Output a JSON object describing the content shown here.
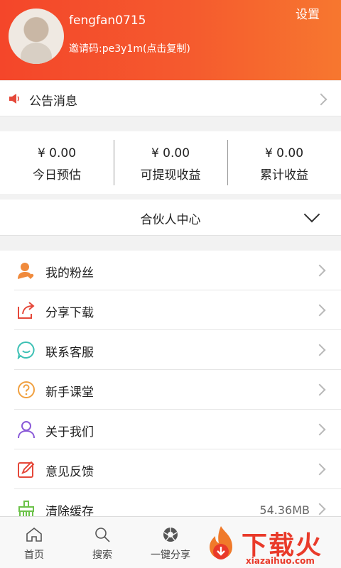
{
  "header": {
    "username": "fengfan0715",
    "invite": "邀请码:pe3y1m(点击复制)",
    "settings": "设置"
  },
  "notice": {
    "label": "公告消息"
  },
  "earnings": [
    {
      "amount": "¥ 0.00",
      "caption": "今日预估"
    },
    {
      "amount": "¥ 0.00",
      "caption": "可提现收益"
    },
    {
      "amount": "¥ 0.00",
      "caption": "累计收益"
    }
  ],
  "partner": {
    "title": "合伙人中心"
  },
  "menu": [
    {
      "label": "我的粉丝",
      "icon": "fans-icon",
      "color": "#f08a3c"
    },
    {
      "label": "分享下载",
      "icon": "share-icon",
      "color": "#e5483a"
    },
    {
      "label": "联系客服",
      "icon": "service-icon",
      "color": "#3cc0b4"
    },
    {
      "label": "新手课堂",
      "icon": "question-icon",
      "color": "#f0a040"
    },
    {
      "label": "关于我们",
      "icon": "user-icon",
      "color": "#8a5ad8"
    },
    {
      "label": "意见反馈",
      "icon": "edit-icon",
      "color": "#e5483a"
    },
    {
      "label": "清除缓存",
      "icon": "broom-icon",
      "color": "#6cc24a",
      "value": "54.36MB"
    }
  ],
  "tabbar": [
    {
      "label": "首页",
      "icon": "home-icon"
    },
    {
      "label": "搜索",
      "icon": "search-icon"
    },
    {
      "label": "一键分享",
      "icon": "aperture-icon"
    }
  ],
  "watermark": {
    "text": "下载火",
    "url": "xiazaihuo.com"
  }
}
